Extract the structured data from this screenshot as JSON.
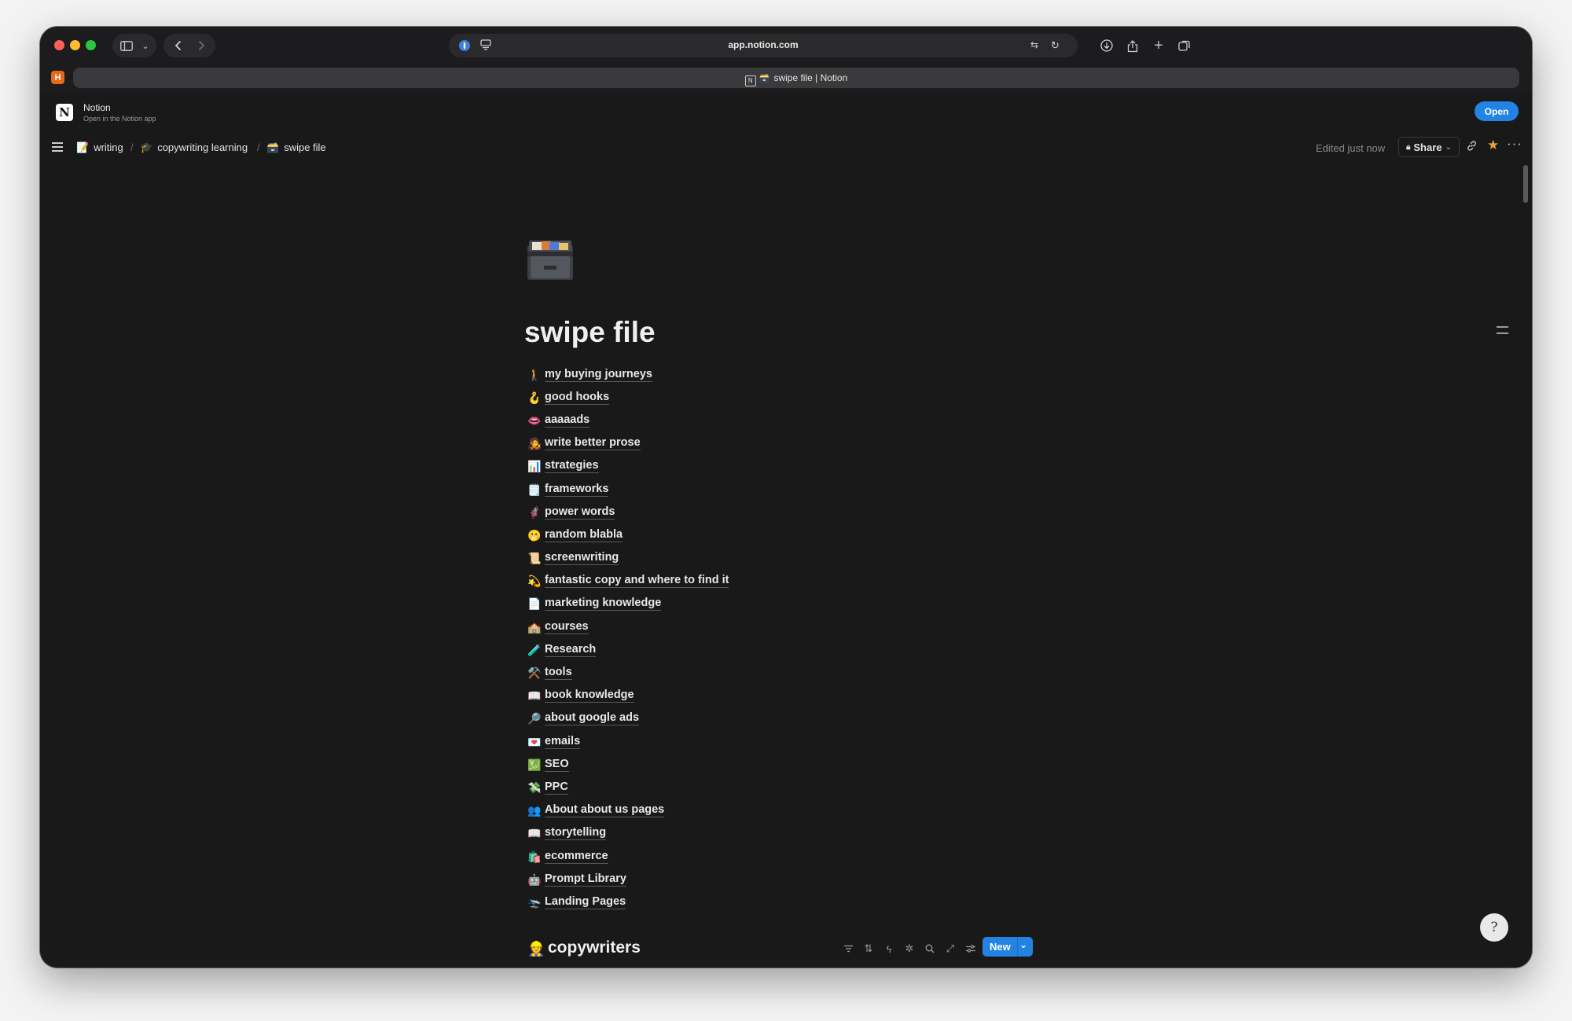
{
  "browser": {
    "url": "app.notion.com",
    "tab_title": "swipe file | Notion",
    "favicon_letter": "H"
  },
  "banner": {
    "app_name": "Notion",
    "subtitle": "Open in the Notion app",
    "open_label": "Open"
  },
  "breadcrumb": [
    {
      "emoji": "📝",
      "label": "writing"
    },
    {
      "emoji": "🎓",
      "label": "copywriting learning"
    },
    {
      "emoji": "🗃️",
      "label": "swipe file"
    }
  ],
  "topbar": {
    "edited": "Edited just now",
    "share_label": "Share"
  },
  "page": {
    "icon": "file-cabinet-icon",
    "title": "swipe file",
    "links": [
      {
        "emoji": "🚶",
        "label": "my buying journeys"
      },
      {
        "emoji": "🪝",
        "label": "good hooks"
      },
      {
        "emoji": "👄",
        "label": "aaaaads"
      },
      {
        "emoji": "🧑‍🎤",
        "label": "write better prose"
      },
      {
        "emoji": "📊",
        "label": "strategies"
      },
      {
        "emoji": "🗒️",
        "label": "frameworks"
      },
      {
        "emoji": "🦸",
        "label": "power words"
      },
      {
        "emoji": "🫢",
        "label": "random blabla"
      },
      {
        "emoji": "📜",
        "label": "screenwriting"
      },
      {
        "emoji": "💫",
        "label": "fantastic copy and where to find it"
      },
      {
        "emoji": "📄",
        "label": "marketing knowledge"
      },
      {
        "emoji": "🏫",
        "label": "courses"
      },
      {
        "emoji": "🧪",
        "label": "Research"
      },
      {
        "emoji": "⚒️",
        "label": "tools"
      },
      {
        "emoji": "📖",
        "label": "book knowledge"
      },
      {
        "emoji": "🔎",
        "label": "about google ads"
      },
      {
        "emoji": "💌",
        "label": "emails"
      },
      {
        "emoji": "💹",
        "label": "SEO"
      },
      {
        "emoji": "💸",
        "label": "PPC"
      },
      {
        "emoji": "👥",
        "label": "About about us pages"
      },
      {
        "emoji": "📖",
        "label": "storytelling"
      },
      {
        "emoji": "🛍️",
        "label": "ecommerce"
      },
      {
        "emoji": "🤖",
        "label": "Prompt Library"
      },
      {
        "emoji": "🛬",
        "label": "Landing Pages"
      }
    ]
  },
  "database": {
    "emoji": "👷",
    "title": "copywriters",
    "new_label": "New"
  },
  "help": {
    "glyph": "?"
  },
  "colors": {
    "background": "#191919",
    "accent": "#2383e2",
    "star": "#e8a33d",
    "text": "#e8e8e8"
  }
}
